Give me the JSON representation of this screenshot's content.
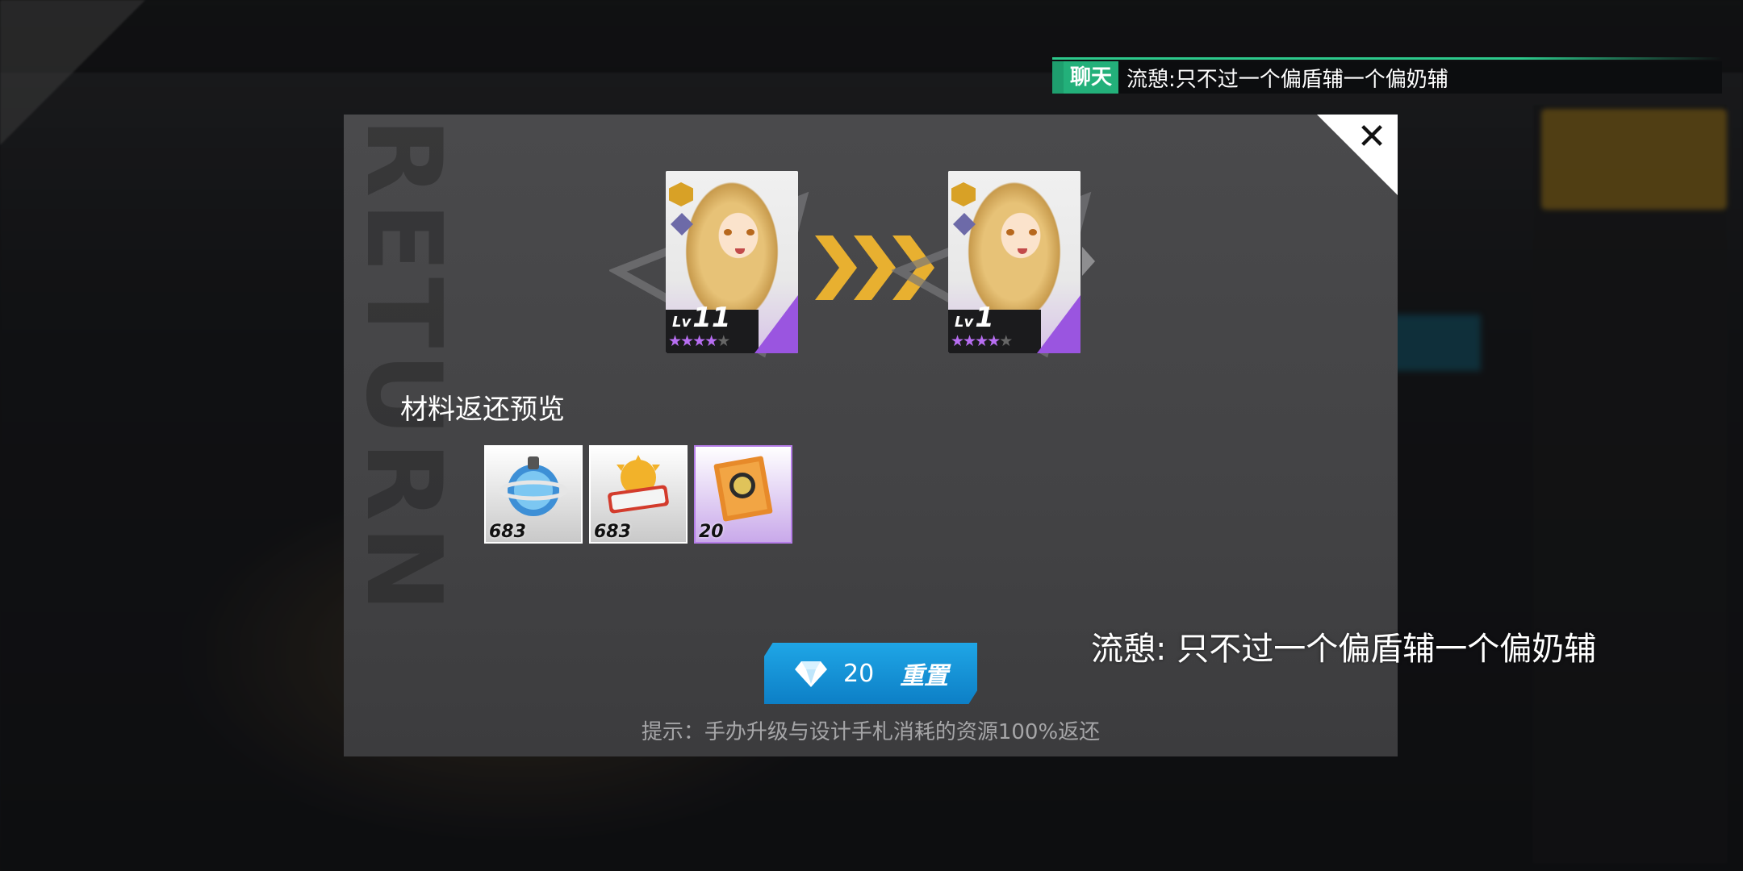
{
  "chat": {
    "tag": "聊天",
    "message": "流憩:只不过一个偏盾辅一个偏奶辅"
  },
  "modal": {
    "watermark": "RETURN",
    "close_icon": "close-icon",
    "card_before": {
      "lv_prefix": "Lv",
      "level": "11",
      "stars_filled": 4,
      "stars_total": 5
    },
    "card_after": {
      "lv_prefix": "Lv",
      "level": "1",
      "stars_filled": 4,
      "stars_total": 5
    },
    "materials_title": "材料返还预览",
    "items": [
      {
        "icon": "blue-orb-material-icon",
        "count": "683"
      },
      {
        "icon": "experience-badge-icon",
        "count": "683"
      },
      {
        "icon": "stamp-ticket-icon",
        "count": "20"
      }
    ],
    "reset_button": {
      "icon": "diamond-icon",
      "cost": "20",
      "label": "重置"
    },
    "hint": "提示：手办升级与设计手札消耗的资源100%返还"
  },
  "floating_chat": "流憩: 只不过一个偏盾辅一个偏奶辅",
  "colors": {
    "accent_blue": "#1fa6e6",
    "chat_green": "#23b07a",
    "rarity_purple": "#9a55e0",
    "arrow_gold": "#e8b030"
  }
}
